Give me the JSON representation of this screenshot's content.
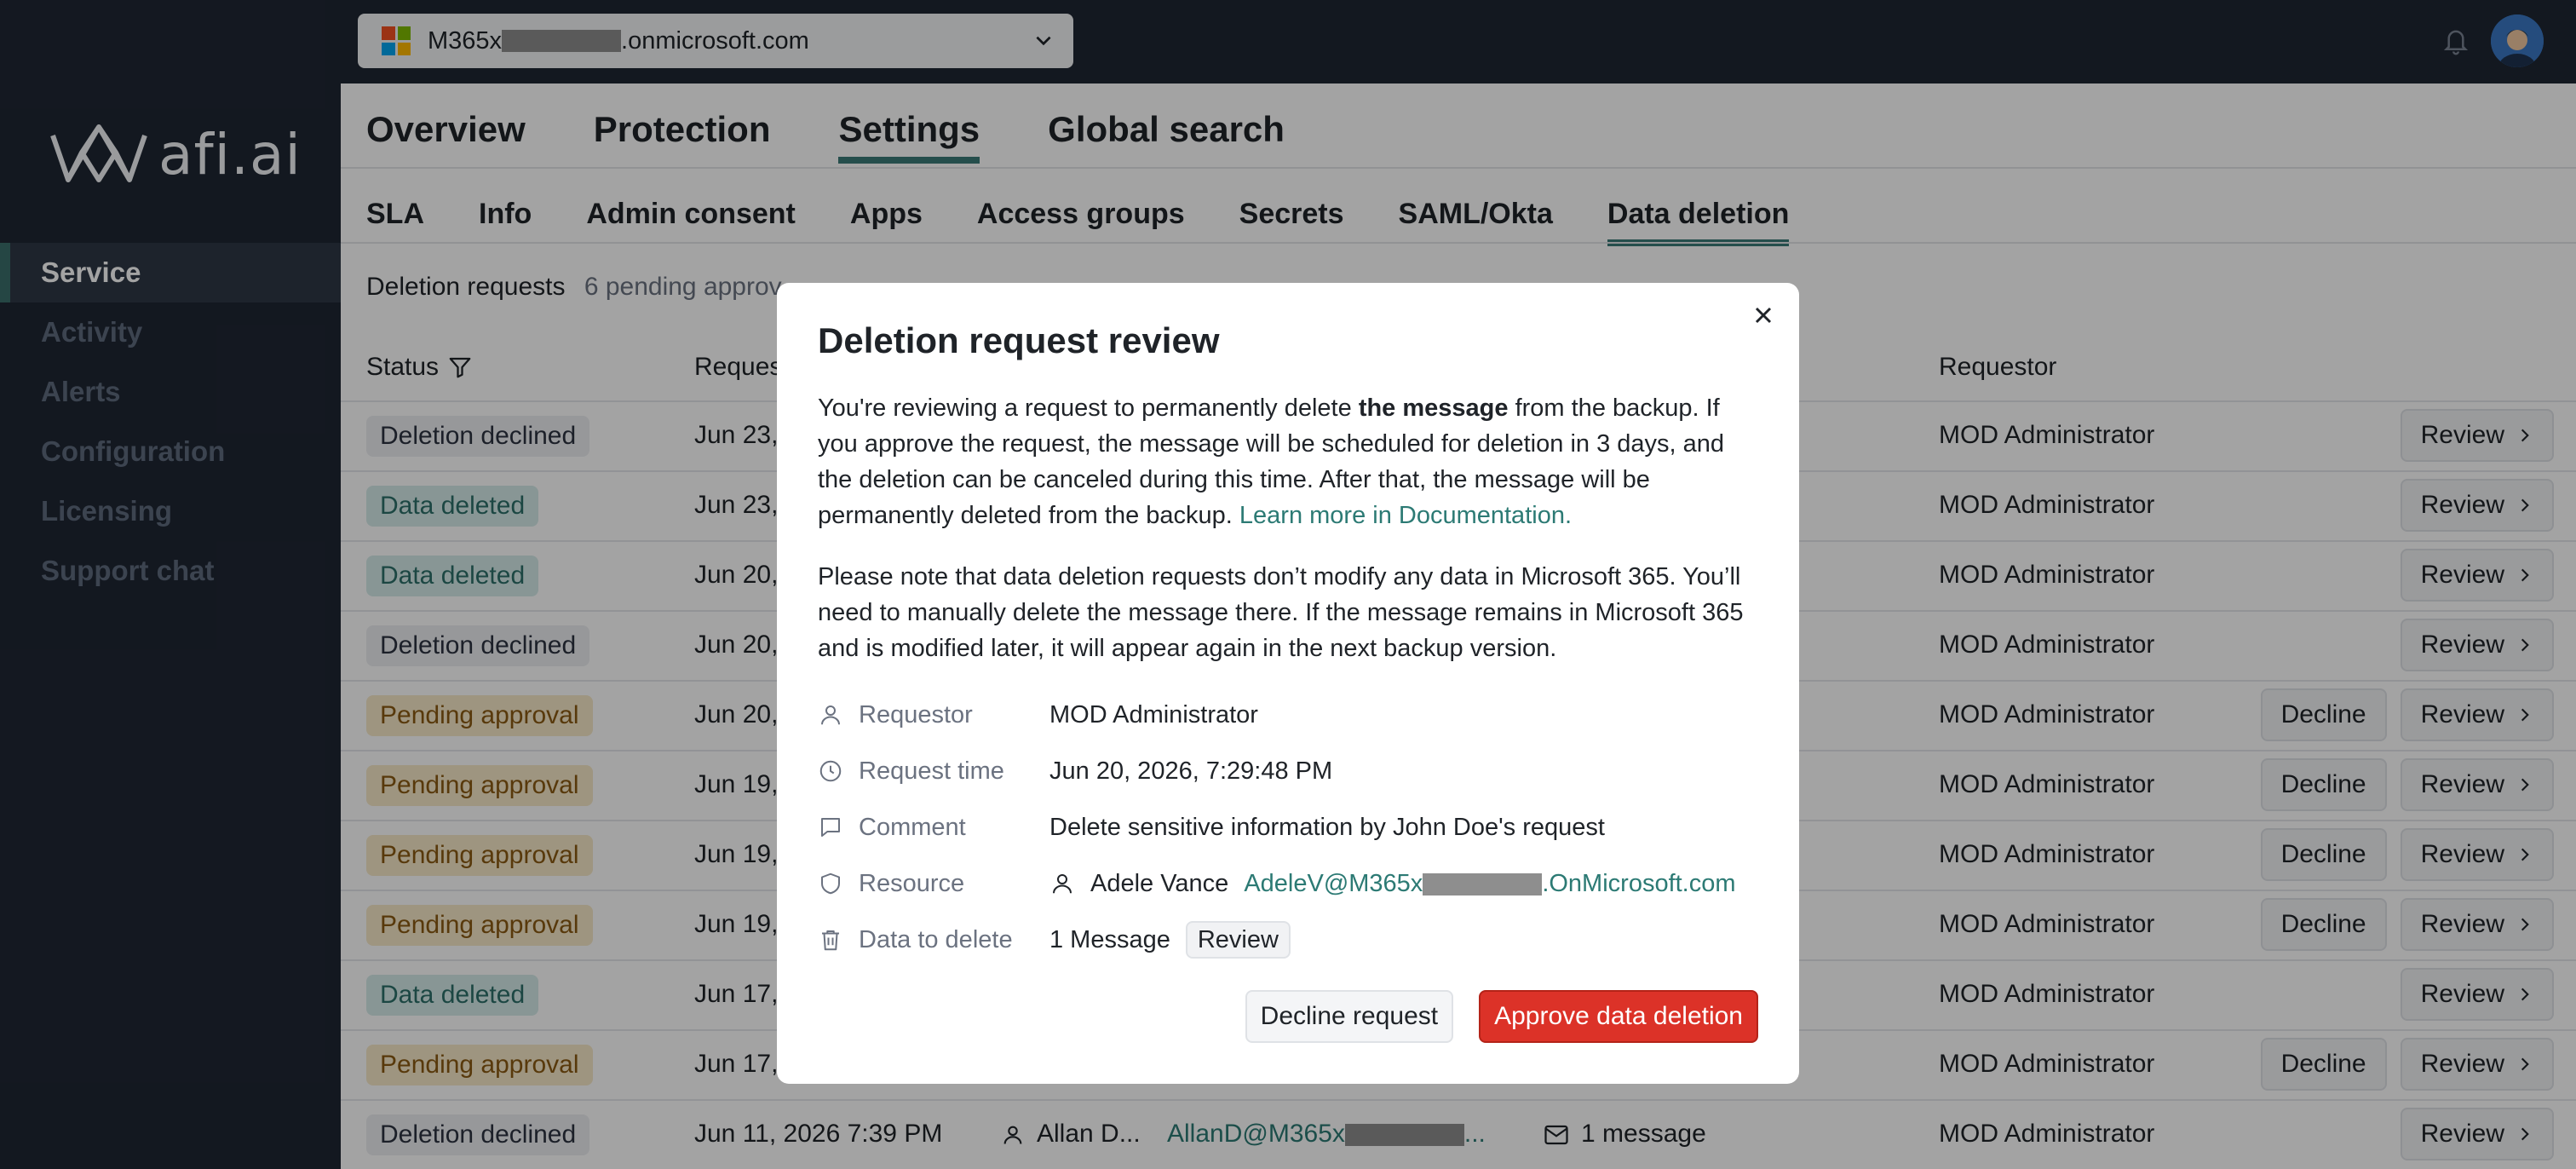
{
  "topbar": {
    "tenant_prefix": "M365x",
    "tenant_suffix": ".onmicrosoft.com"
  },
  "brand": {
    "logo_text": "afi.ai"
  },
  "sidebar": {
    "items": [
      {
        "label": "Service"
      },
      {
        "label": "Activity"
      },
      {
        "label": "Alerts"
      },
      {
        "label": "Configuration"
      },
      {
        "label": "Licensing"
      },
      {
        "label": "Support chat"
      }
    ]
  },
  "main_tabs": [
    {
      "label": "Overview"
    },
    {
      "label": "Protection"
    },
    {
      "label": "Settings"
    },
    {
      "label": "Global search"
    }
  ],
  "sub_tabs": [
    {
      "label": "SLA"
    },
    {
      "label": "Info"
    },
    {
      "label": "Admin consent"
    },
    {
      "label": "Apps"
    },
    {
      "label": "Access groups"
    },
    {
      "label": "Secrets"
    },
    {
      "label": "SAML/Okta"
    },
    {
      "label": "Data deletion"
    }
  ],
  "deletion": {
    "title": "Deletion requests",
    "pending": "6 pending approv"
  },
  "table": {
    "headers": {
      "status": "Status",
      "request": "Reques",
      "requestor": "Requestor"
    },
    "rows": [
      {
        "status": "Deletion declined",
        "date": "Jun 23,",
        "requestor": "MOD Administrator"
      },
      {
        "status": "Data deleted",
        "date": "Jun 23,",
        "requestor": "MOD Administrator"
      },
      {
        "status": "Data deleted",
        "date": "Jun 20,",
        "requestor": "MOD Administrator"
      },
      {
        "status": "Deletion declined",
        "date": "Jun 20,",
        "requestor": "MOD Administrator"
      },
      {
        "status": "Pending approval",
        "date": "Jun 20,",
        "requestor": "MOD Administrator"
      },
      {
        "status": "Pending approval",
        "date": "Jun 19,",
        "requestor": "MOD Administrator"
      },
      {
        "status": "Pending approval",
        "date": "Jun 19,",
        "requestor": "MOD Administrator"
      },
      {
        "status": "Pending approval",
        "date": "Jun 19,",
        "requestor": "MOD Administrator"
      },
      {
        "status": "Data deleted",
        "date": "Jun 17,",
        "requestor": "MOD Administrator"
      },
      {
        "status": "Pending approval",
        "date": "Jun 17,",
        "requestor": "MOD Administrator"
      },
      {
        "status": "Deletion declined",
        "date": "Jun 11, 2026 7:39 PM",
        "requestor": "MOD Administrator"
      }
    ],
    "last_row": {
      "user": "Allan D...",
      "email_prefix": "AllanD@M365x",
      "email_suffix": "...",
      "count": "1 message"
    },
    "review_label": "Review",
    "decline_label": "Decline"
  },
  "modal": {
    "title": "Deletion request review",
    "p1_a": "You're reviewing a request to permanently delete ",
    "p1_b": "the message",
    "p1_c": " from the backup. If you approve the request, the message will be scheduled for deletion in 3 days, and the deletion can be canceled during this time. After that, the message will be permanently deleted from the backup. ",
    "p1_link": "Learn more in Documentation.",
    "p2": "Please note that data deletion requests don’t modify any data in Microsoft 365. You’ll need to manually delete the message there. If the message remains in Microsoft 365 and is modified later, it will appear again in the next backup version.",
    "details": {
      "requestor_label": "Requestor",
      "requestor_value": "MOD Administrator",
      "time_label": "Request time",
      "time_value": "Jun 20, 2026, 7:29:48 PM",
      "comment_label": "Comment",
      "comment_value": "Delete sensitive information by John Doe's request",
      "resource_label": "Resource",
      "resource_name": "Adele Vance",
      "resource_email_prefix": "AdeleV@M365x",
      "resource_email_suffix": ".OnMicrosoft.com",
      "data_label": "Data to delete",
      "data_value": "1 Message",
      "data_review": "Review"
    },
    "decline_button": "Decline request",
    "approve_button": "Approve data deletion"
  },
  "colors": {
    "accent": "#3b7b78",
    "danger": "#dc3228",
    "sidebar_bg": "#1f2633"
  }
}
